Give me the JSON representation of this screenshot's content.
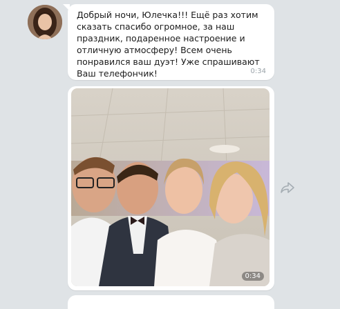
{
  "message": {
    "text": "Добрый ночи, Юлечка!!! Ещё раз хотим сказать спасибо огромное, за наш праздник, подаренное настроение и отличную атмосферу! Всем очень понравился ваш дуэт! Уже спрашивают Ваш телефончик!",
    "time": "0:34"
  },
  "photo_message": {
    "time": "0:34"
  },
  "icons": {
    "forward": "forward-arrow-icon",
    "avatar": "contact-avatar"
  },
  "colors": {
    "background": "#dfe3e6",
    "bubble": "#ffffff",
    "timestamp": "#9aa3a9"
  }
}
